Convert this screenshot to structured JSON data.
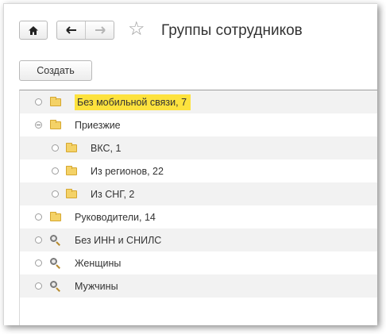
{
  "window": {
    "title": "Группы сотрудников",
    "buttons": {
      "home_icon": "home-icon",
      "back_icon": "arrow-left-icon",
      "forward_icon": "arrow-right-icon",
      "favorite_icon": "star-icon"
    }
  },
  "toolbar": {
    "create_label": "Создать"
  },
  "tree": {
    "items": [
      {
        "label": "Без мобильной связи, 7",
        "icon": "folder-icon",
        "level": 0,
        "highlighted": true,
        "expanded": false
      },
      {
        "label": "Приезжие",
        "icon": "folder-icon",
        "level": 0,
        "highlighted": false,
        "expanded": true
      },
      {
        "label": "ВКС, 1",
        "icon": "folder-icon",
        "level": 1,
        "highlighted": false,
        "expanded": false
      },
      {
        "label": "Из регионов, 22",
        "icon": "folder-icon",
        "level": 1,
        "highlighted": false,
        "expanded": false
      },
      {
        "label": "Из СНГ, 2",
        "icon": "folder-icon",
        "level": 1,
        "highlighted": false,
        "expanded": false
      },
      {
        "label": "Руководители, 14",
        "icon": "folder-icon",
        "level": 0,
        "highlighted": false,
        "expanded": false
      },
      {
        "label": "Без ИНН и СНИЛС",
        "icon": "magnifier-icon",
        "level": 0,
        "highlighted": false,
        "expanded": false
      },
      {
        "label": "Женщины",
        "icon": "magnifier-icon",
        "level": 0,
        "highlighted": false,
        "expanded": false
      },
      {
        "label": "Мужчины",
        "icon": "magnifier-icon",
        "level": 0,
        "highlighted": false,
        "expanded": false
      }
    ]
  },
  "colors": {
    "highlight": "#fde23d",
    "row_alt": "#f2f2f2",
    "folder": "#f4d267"
  }
}
